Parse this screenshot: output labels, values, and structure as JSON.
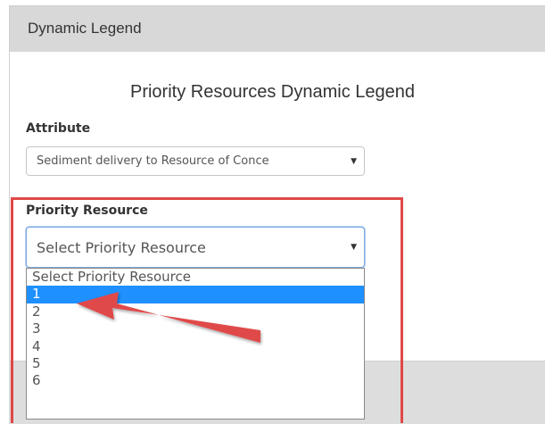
{
  "panel": {
    "header_title": "Dynamic Legend",
    "legend_title": "Priority Resources Dynamic Legend"
  },
  "attribute": {
    "label": "Attribute",
    "selected_value": "Sediment delivery to Resource of Conce"
  },
  "priority_resource": {
    "label": "Priority Resource",
    "selected_value": "Select Priority Resource",
    "options": [
      "Select Priority Resource",
      "1",
      "2",
      "3",
      "4",
      "5",
      "6"
    ],
    "highlighted_option": "1"
  },
  "annotation": {
    "highlight_color": "#e04848",
    "arrow_color": "#e04848",
    "selected_option_color": "#1e90ff"
  },
  "icons": {
    "dropdown_caret": "caret-down-icon",
    "annotation_arrow": "red-arrow-icon"
  }
}
